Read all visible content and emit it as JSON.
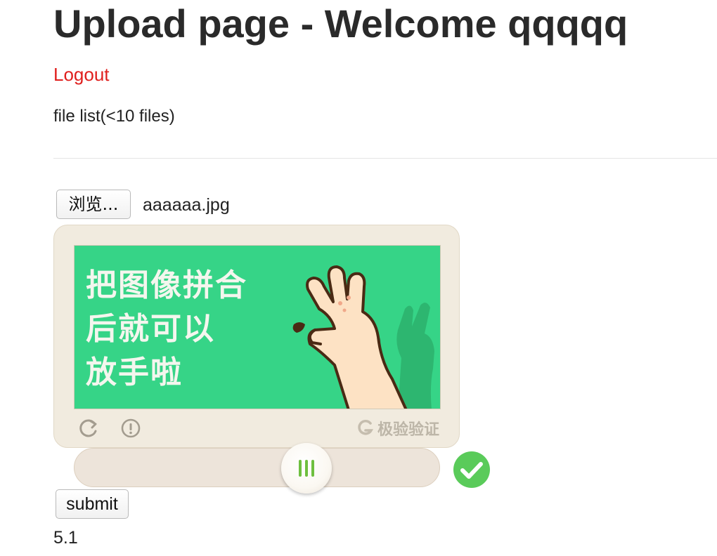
{
  "page": {
    "title": "Upload page - Welcome qqqqq",
    "logout_label": "Logout",
    "file_list_label": "file list(<10 files)"
  },
  "upload": {
    "browse_label": "浏览...",
    "selected_file": "aaaaaa.jpg",
    "submit_label": "submit"
  },
  "captcha": {
    "instruction_lines": [
      "把图像拼合",
      "后就可以",
      "放手啦"
    ],
    "brand_text": "极验验证",
    "image_bg_color": "#36d487",
    "frame_color": "#f1ebdf",
    "slider_progress": 0.57,
    "status": "verified",
    "success_color": "#5acb5a",
    "icons": [
      "refresh-icon",
      "info-icon",
      "geetest-logo-icon",
      "slider-grip-icon",
      "checkmark-icon"
    ]
  },
  "footer": {
    "version": "5.1"
  },
  "colors": {
    "link": "#e0201e",
    "text": "#222222"
  }
}
